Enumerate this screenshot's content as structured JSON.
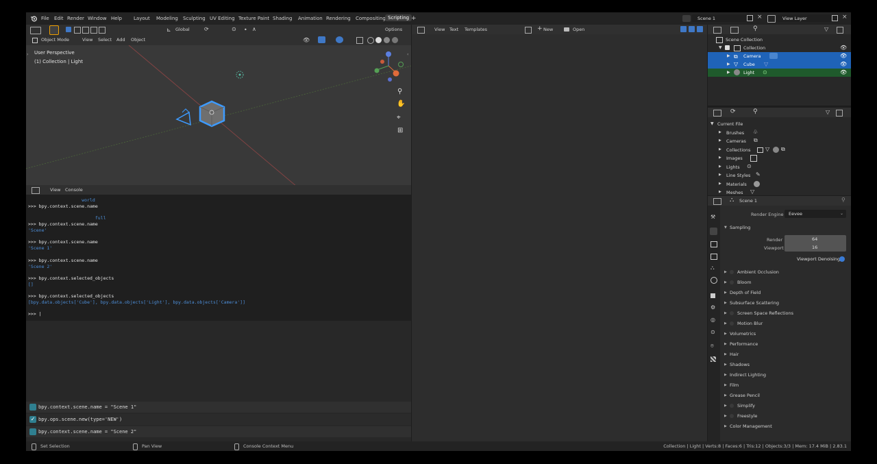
{
  "topbar": {
    "menus": [
      "File",
      "Edit",
      "Render",
      "Window",
      "Help"
    ],
    "workspaces": [
      "Layout",
      "Modeling",
      "Sculpting",
      "UV Editing",
      "Texture Paint",
      "Shading",
      "Animation",
      "Rendering",
      "Compositing",
      "Scripting"
    ],
    "active_workspace": "Scripting",
    "scene_name": "Scene 1",
    "view_layer": "View Layer"
  },
  "viewport": {
    "transform_orientation": "Global",
    "options_label": "Options",
    "mode": "Object Mode",
    "menus": [
      "View",
      "Select",
      "Add",
      "Object"
    ],
    "overlay_title": "User Perspective",
    "overlay_subtitle": "(1) Collection | Light"
  },
  "console": {
    "menus": [
      "View",
      "Console"
    ],
    "lines": [
      {
        "type": "out",
        "text": "                    world"
      },
      {
        "type": "cmd",
        "text": ">>> bpy.context.scene.name"
      },
      {
        "type": "out",
        "text": "                         full"
      },
      {
        "type": "cmd",
        "text": ">>> bpy.context.scene.name"
      },
      {
        "type": "out",
        "text": "'Scene'"
      },
      {
        "type": "cmd",
        "text": ">>> bpy.context.scene.name"
      },
      {
        "type": "out",
        "text": "'Scene 1'"
      },
      {
        "type": "cmd",
        "text": ">>> bpy.context.scene.name"
      },
      {
        "type": "out",
        "text": "'Scene 2'"
      },
      {
        "type": "cmd",
        "text": ">>> bpy.context.selected_objects"
      },
      {
        "type": "out",
        "text": "[]"
      },
      {
        "type": "cmd",
        "text": ">>> bpy.context.selected_objects"
      },
      {
        "type": "out",
        "text": "[bpy.data.objects['Cube'], bpy.data.objects['Light'], bpy.data.objects['Camera']]"
      },
      {
        "type": "cmd",
        "text": ">>> |"
      }
    ]
  },
  "info_log": [
    {
      "text": "bpy.context.scene.name = \"Scene 1\"",
      "kind": "property"
    },
    {
      "text": "bpy.ops.scene.new(type='NEW')",
      "kind": "operator"
    },
    {
      "text": "bpy.context.scene.name = \"Scene 2\"",
      "kind": "property"
    }
  ],
  "text_editor": {
    "menus": [
      "View",
      "Text",
      "Templates"
    ],
    "new_label": "New",
    "open_label": "Open"
  },
  "outliner": {
    "root": "Scene Collection",
    "collection": "Collection",
    "objects": [
      "Camera",
      "Cube",
      "Light"
    ]
  },
  "data_api": {
    "root": "Current File",
    "items": [
      "Brushes",
      "Cameras",
      "Collections",
      "Images",
      "Lights",
      "Line Styles",
      "Materials",
      "Meshes"
    ]
  },
  "properties": {
    "scene_name": "Scene 1",
    "render_engine_label": "Render Engine",
    "render_engine": "Eevee",
    "sampling_label": "Sampling",
    "render_label": "Render",
    "render_samples": "64",
    "viewport_label": "Viewport",
    "viewport_samples": "16",
    "denoise_label": "Viewport Denoising",
    "panels": [
      {
        "label": "Ambient Occlusion",
        "check": true
      },
      {
        "label": "Bloom",
        "check": true
      },
      {
        "label": "Depth of Field",
        "check": false
      },
      {
        "label": "Subsurface Scattering",
        "check": false
      },
      {
        "label": "Screen Space Reflections",
        "check": true
      },
      {
        "label": "Motion Blur",
        "check": true
      },
      {
        "label": "Volumetrics",
        "check": false
      },
      {
        "label": "Performance",
        "check": false
      },
      {
        "label": "Hair",
        "check": false
      },
      {
        "label": "Shadows",
        "check": false
      },
      {
        "label": "Indirect Lighting",
        "check": false
      },
      {
        "label": "Film",
        "check": false
      },
      {
        "label": "Grease Pencil",
        "check": false
      },
      {
        "label": "Simplify",
        "check": true
      },
      {
        "label": "Freestyle",
        "check": true
      },
      {
        "label": "Color Management",
        "check": false
      }
    ]
  },
  "statusbar": {
    "left": "Set Selection",
    "middle": "Pan View",
    "right_hint": "Console Context Menu",
    "stats": "Collection | Light | Verts:8 | Faces:6 | Tris:12 | Objects:3/3 | Mem: 17.4 MiB | 2.83.1"
  },
  "colors": {
    "selection_blue": "#1f63b8",
    "active_green": "#1f5a2c",
    "console_output": "#4d8ed8",
    "object_outline": "#3d9bff"
  }
}
